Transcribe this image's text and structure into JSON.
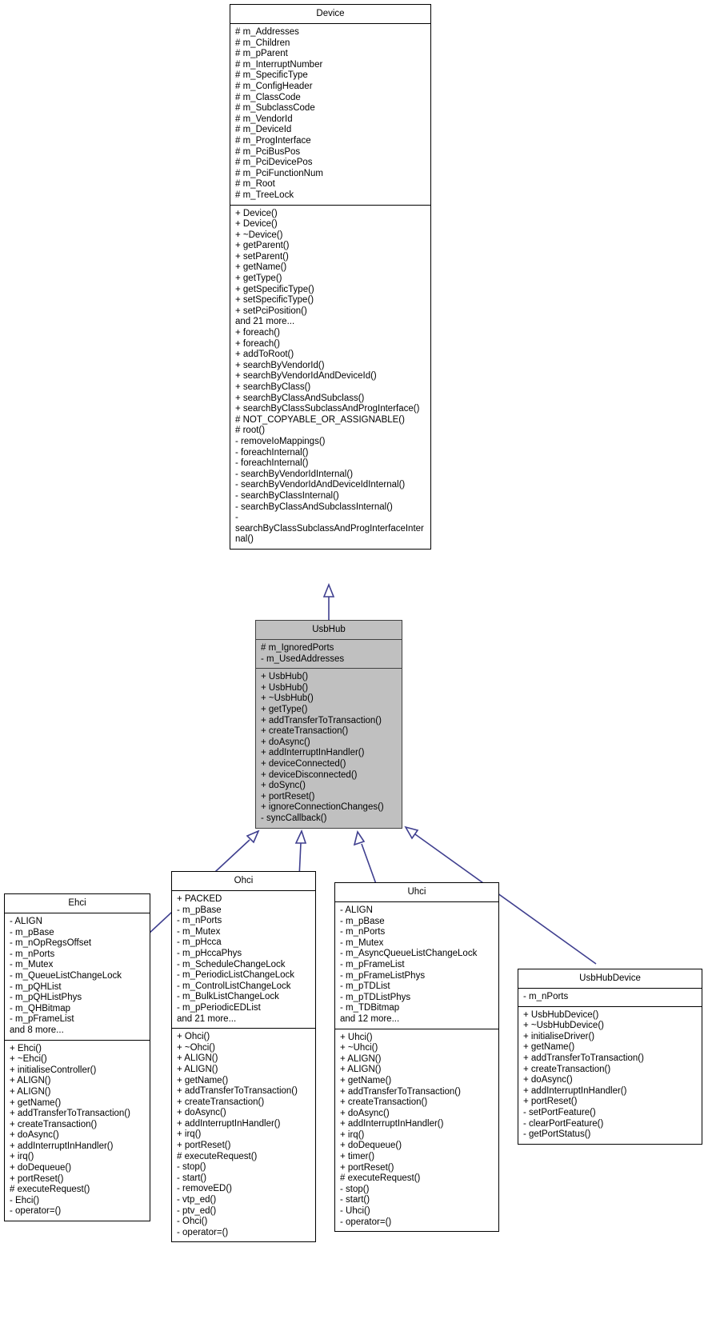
{
  "diagram": {
    "type": "uml-class-diagram",
    "title": "",
    "classes": [
      {
        "id": "device",
        "name": "Device",
        "highlighted": false,
        "attributes": [
          "# m_Addresses",
          "# m_Children",
          "# m_pParent",
          "# m_InterruptNumber",
          "# m_SpecificType",
          "# m_ConfigHeader",
          "# m_ClassCode",
          "# m_SubclassCode",
          "# m_VendorId",
          "# m_DeviceId",
          "# m_ProgInterface",
          "# m_PciBusPos",
          "# m_PciDevicePos",
          "# m_PciFunctionNum",
          "# m_Root",
          "# m_TreeLock"
        ],
        "operations": [
          "+ Device()",
          "+ Device()",
          "+ ~Device()",
          "+ getParent()",
          "+ setParent()",
          "+ getName()",
          "+ getType()",
          "+ getSpecificType()",
          "+ setSpecificType()",
          "+ setPciPosition()",
          "and 21 more...",
          "+ foreach()",
          "+ foreach()",
          "+ addToRoot()",
          "+ searchByVendorId()",
          "+ searchByVendorIdAndDeviceId()",
          "+ searchByClass()",
          "+ searchByClassAndSubclass()",
          "+ searchByClassSubclassAndProgInterface()",
          "# NOT_COPYABLE_OR_ASSIGNABLE()",
          "# root()",
          "- removeIoMappings()",
          "- foreachInternal()",
          "- foreachInternal()",
          "- searchByVendorIdInternal()",
          "- searchByVendorIdAndDeviceIdInternal()",
          "- searchByClassInternal()",
          "- searchByClassAndSubclassInternal()",
          "- searchByClassSubclassAndProgInterfaceInternal()"
        ]
      },
      {
        "id": "usbhub",
        "name": "UsbHub",
        "highlighted": true,
        "attributes": [
          "# m_IgnoredPorts",
          "- m_UsedAddresses"
        ],
        "operations": [
          "+ UsbHub()",
          "+ UsbHub()",
          "+ ~UsbHub()",
          "+ getType()",
          "+ addTransferToTransaction()",
          "+ createTransaction()",
          "+ doAsync()",
          "+ addInterruptInHandler()",
          "+ deviceConnected()",
          "+ deviceDisconnected()",
          "+ doSync()",
          "+ portReset()",
          "+ ignoreConnectionChanges()",
          "- syncCallback()"
        ]
      },
      {
        "id": "ehci",
        "name": "Ehci",
        "highlighted": false,
        "attributes": [
          "- ALIGN",
          "- m_pBase",
          "- m_nOpRegsOffset",
          "- m_nPorts",
          "- m_Mutex",
          "- m_QueueListChangeLock",
          "- m_pQHList",
          "- m_pQHListPhys",
          "- m_QHBitmap",
          "- m_pFrameList",
          "and 8 more..."
        ],
        "operations": [
          "+ Ehci()",
          "+ ~Ehci()",
          "+ initialiseController()",
          "+ ALIGN()",
          "+ ALIGN()",
          "+ getName()",
          "+ addTransferToTransaction()",
          "+ createTransaction()",
          "+ doAsync()",
          "+ addInterruptInHandler()",
          "+ irq()",
          "+ doDequeue()",
          "+ portReset()",
          "# executeRequest()",
          "- Ehci()",
          "- operator=()"
        ]
      },
      {
        "id": "ohci",
        "name": "Ohci",
        "highlighted": false,
        "attributes": [
          "+ PACKED",
          "- m_pBase",
          "- m_nPorts",
          "- m_Mutex",
          "- m_pHcca",
          "- m_pHccaPhys",
          "- m_ScheduleChangeLock",
          "- m_PeriodicListChangeLock",
          "- m_ControlListChangeLock",
          "- m_BulkListChangeLock",
          "- m_pPeriodicEDList",
          "and 21 more..."
        ],
        "operations": [
          "+ Ohci()",
          "+ ~Ohci()",
          "+ ALIGN()",
          "+ ALIGN()",
          "+ getName()",
          "+ addTransferToTransaction()",
          "+ createTransaction()",
          "+ doAsync()",
          "+ addInterruptInHandler()",
          "+ irq()",
          "+ portReset()",
          "# executeRequest()",
          "- stop()",
          "- start()",
          "- removeED()",
          "- vtp_ed()",
          "- ptv_ed()",
          "- Ohci()",
          "- operator=()"
        ]
      },
      {
        "id": "uhci",
        "name": "Uhci",
        "highlighted": false,
        "attributes": [
          "- ALIGN",
          "- m_pBase",
          "- m_nPorts",
          "- m_Mutex",
          "- m_AsyncQueueListChangeLock",
          "- m_pFrameList",
          "- m_pFrameListPhys",
          "- m_pTDList",
          "- m_pTDListPhys",
          "- m_TDBitmap",
          "and 12 more..."
        ],
        "operations": [
          "+ Uhci()",
          "+ ~Uhci()",
          "+ ALIGN()",
          "+ ALIGN()",
          "+ getName()",
          "+ addTransferToTransaction()",
          "+ createTransaction()",
          "+ doAsync()",
          "+ addInterruptInHandler()",
          "+ irq()",
          "+ doDequeue()",
          "+ timer()",
          "+ portReset()",
          "# executeRequest()",
          "- stop()",
          "- start()",
          "- Uhci()",
          "- operator=()"
        ]
      },
      {
        "id": "usbhubdevice",
        "name": "UsbHubDevice",
        "highlighted": false,
        "attributes": [
          "- m_nPorts"
        ],
        "operations": [
          "+ UsbHubDevice()",
          "+ ~UsbHubDevice()",
          "+ initialiseDriver()",
          "+ getName()",
          "+ addTransferToTransaction()",
          "+ createTransaction()",
          "+ doAsync()",
          "+ addInterruptInHandler()",
          "+ portReset()",
          "- setPortFeature()",
          "- clearPortFeature()",
          "- getPortStatus()"
        ]
      }
    ],
    "relations": [
      {
        "from": "usbhub",
        "to": "device",
        "type": "inheritance"
      },
      {
        "from": "ehci",
        "to": "usbhub",
        "type": "inheritance"
      },
      {
        "from": "ohci",
        "to": "usbhub",
        "type": "inheritance"
      },
      {
        "from": "uhci",
        "to": "usbhub",
        "type": "inheritance"
      },
      {
        "from": "usbhubdevice",
        "to": "usbhub",
        "type": "inheritance"
      }
    ],
    "colors": {
      "edge": "#3f3f8f",
      "border": "#000000",
      "highlight_fill": "#c0c0c0",
      "background": "#ffffff",
      "text": "#000000"
    }
  }
}
